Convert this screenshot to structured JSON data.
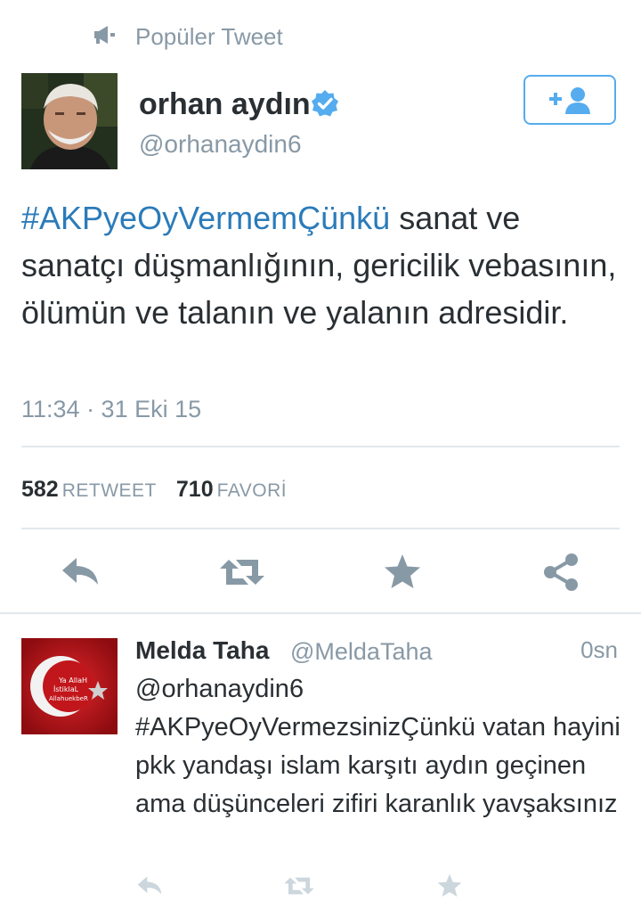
{
  "context": {
    "label": "Popüler Tweet",
    "icon": "megaphone-icon"
  },
  "tweet": {
    "author_name": "orhan aydın",
    "author_handle": "@orhanaydin6",
    "verified": true,
    "hashtag": "#AKPyeOyVermemÇünkü",
    "text": " sanat ve sanatçı düşmanlığının, gericilik vebasının, ölümün ve talanın ve yalanın adresidir.",
    "timestamp": "11:34 · 31 Eki 15",
    "retweet_count": "582",
    "retweet_label": "RETWEET",
    "favorite_count": "710",
    "favorite_label": "FAVORİ"
  },
  "actions": [
    "reply-icon",
    "retweet-icon",
    "favorite-star-icon",
    "share-icon"
  ],
  "reply": {
    "author_name": "Melda Taha",
    "author_handle": "@MeldaTaha",
    "time": "0sn",
    "text": "@orhanaydin6 #AKPyeOyVermezsinizÇünkü  vatan hayini pkk yandaşı islam karşıtı aydın geçinen ama düşünceleri zifiri karanlık yavşaksınız",
    "avatar_text_1": "Ya AllaH",
    "avatar_text_2": "İstiklaL",
    "avatar_text_3": "AllahuekbeR"
  },
  "colors": {
    "accent": "#55acee",
    "hashtag": "#2b7bb9",
    "muted": "#8899a6",
    "text": "#292f33",
    "divider": "#e1e8ed"
  }
}
